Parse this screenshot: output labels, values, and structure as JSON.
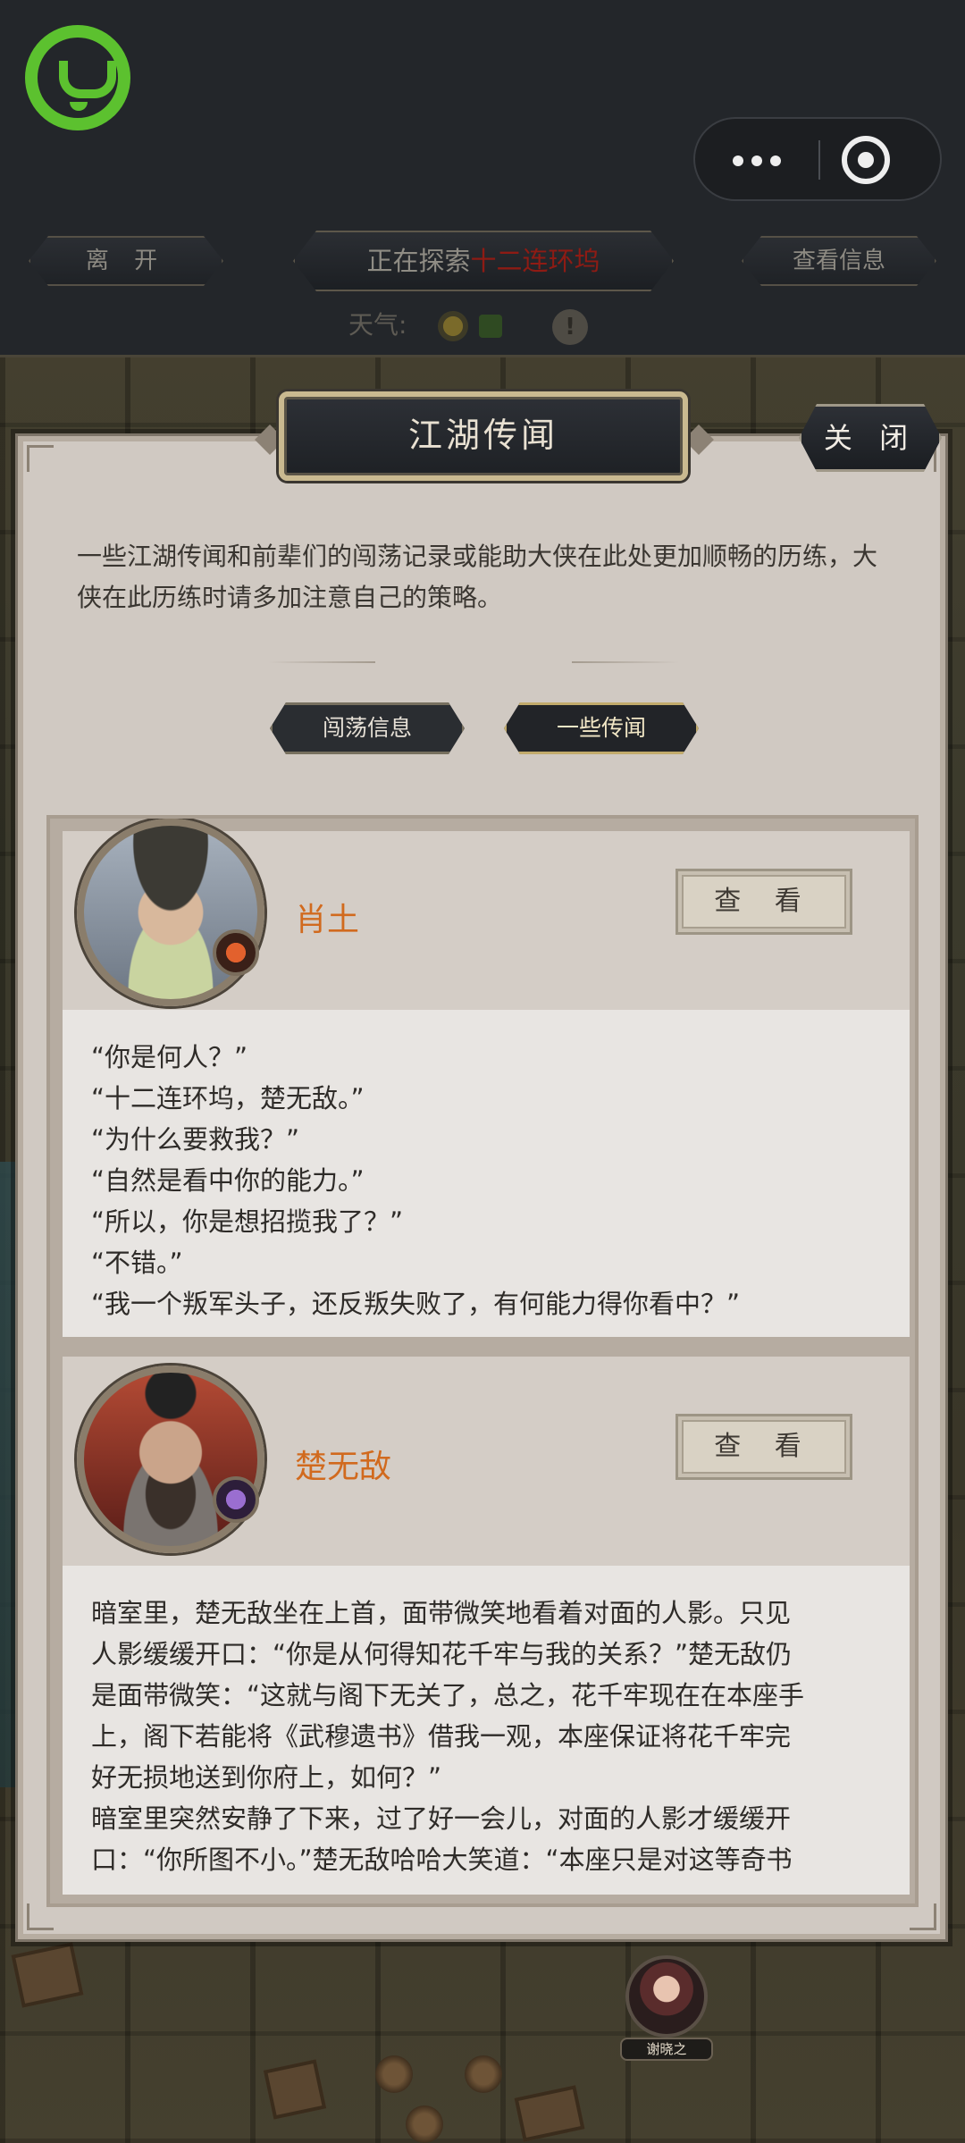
{
  "topbar": {
    "leave_label": "离 开",
    "exploring_prefix": "正在探索",
    "exploring_place": "十二连环坞",
    "view_info_label": "查看信息",
    "weather_label": "天气:",
    "weather_alert_glyph": "!",
    "capsule_more_icon": "more-dots-icon",
    "capsule_close_icon": "target-close-icon"
  },
  "panel": {
    "title": "江湖传闻",
    "close_label": "关 闭",
    "intro": "一些江湖传闻和前辈们的闯荡记录或能助大侠在此处更加顺畅的历练，大侠在此历练时请多加注意自己的策略。",
    "tabs": [
      {
        "label": "闯荡信息",
        "active": false
      },
      {
        "label": "一些传闻",
        "active": true
      }
    ]
  },
  "entries": [
    {
      "name": "肖土",
      "view_label": "查 看",
      "lines": [
        "“你是何人？”",
        "“十二连环坞，楚无敌。”",
        "“为什么要救我？”",
        "“自然是看中你的能力。”",
        "“所以，你是想招揽我了？”",
        "“不错。”",
        "“我一个叛军头子，还反叛失败了，有何能力得你看中？”"
      ]
    },
    {
      "name": "楚无敌",
      "view_label": "查 看",
      "lines": [
        "暗室里，楚无敌坐在上首，面带微笑地看着对面的人影。只见",
        "人影缓缓开口：“你是从何得知花千牢与我的关系？”楚无敌仍",
        "是面带微笑：“这就与阁下无关了，总之，花千牢现在在本座手",
        "上，阁下若能将《武穆遗书》借我一观，本座保证将花千牢完",
        "好无损地送到你府上，如何？”",
        "暗室里突然安静了下来，过了好一会儿，对面的人影才缓缓开",
        "口：“你所图不小。”楚无敌哈哈大笑道：“本座只是对这等奇书"
      ]
    }
  ],
  "background": {
    "npc_name": "谢晓之"
  },
  "colors": {
    "accent_name": "#d16a1e",
    "place_red": "#8e1b14",
    "wechat_green": "#5cc12f",
    "panel_bg": "#d0c9c2"
  }
}
